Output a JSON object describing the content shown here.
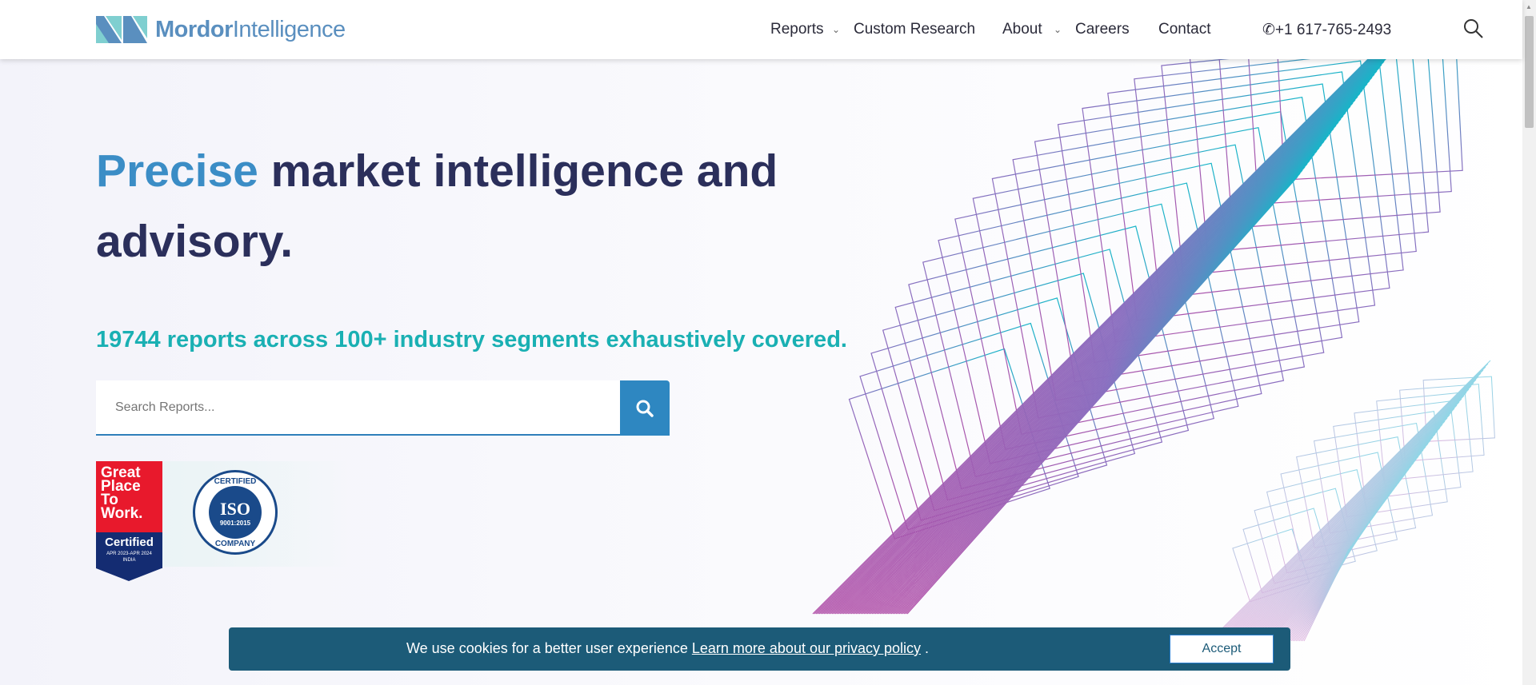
{
  "header": {
    "logo_bold": "Mordor",
    "logo_light": "Intelligence",
    "nav": [
      {
        "label": "Reports",
        "dropdown": true
      },
      {
        "label": "Custom Research"
      },
      {
        "label": "About",
        "dropdown": true
      },
      {
        "label": "Careers"
      },
      {
        "label": "Contact"
      }
    ],
    "phone": "+1 617-765-2493"
  },
  "hero": {
    "title_accent": "Precise",
    "title_rest": " market intelligence and advisory.",
    "subtitle": "19744 reports across 100+ industry segments exhaustively covered.",
    "search_placeholder": "Search Reports..."
  },
  "badges": {
    "gptw": {
      "lines": [
        "Great",
        "Place",
        "To",
        "Work."
      ],
      "certified": "Certified",
      "period": "APR 2023-APR 2024",
      "country": "INDIA"
    },
    "iso": {
      "top": "CERTIFIED",
      "main": "ISO",
      "standard": "9001:2015",
      "bottom": "COMPANY"
    }
  },
  "cookie": {
    "message": "We use cookies for a better user experience ",
    "link": "Learn more about our privacy policy",
    "end": " .",
    "accept": "Accept"
  },
  "colors": {
    "accent": "#3b8dc6",
    "navy": "#2b2f5b",
    "teal": "#1ab0b3",
    "cookie_bg": "#1c5b78"
  }
}
